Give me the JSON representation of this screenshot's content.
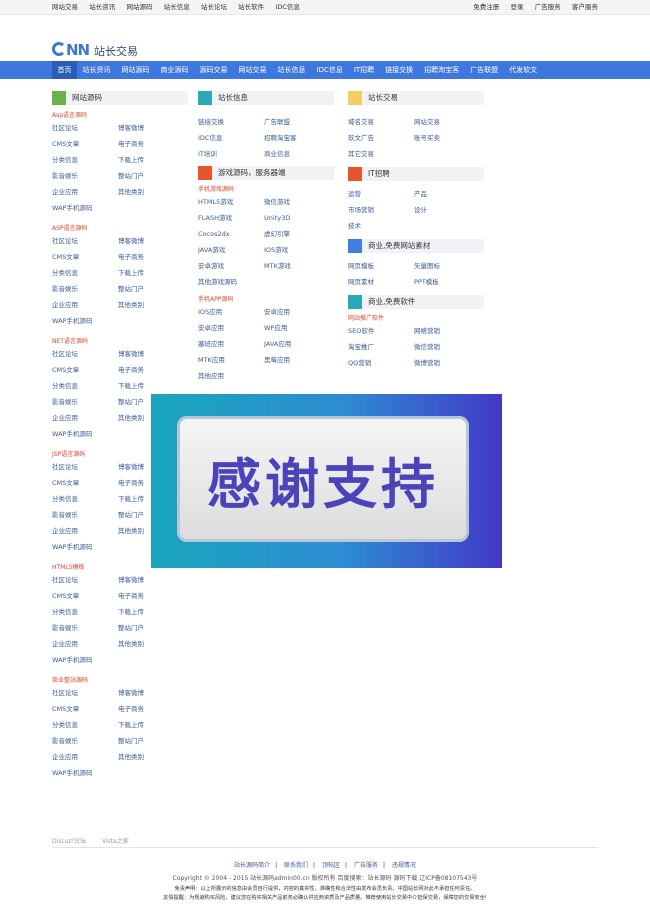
{
  "topbar": {
    "left": [
      "网站交易",
      "站长资讯",
      "网站源码",
      "站长信息",
      "站长论坛",
      "站长软件",
      "IDC信息"
    ],
    "right": [
      "免费注册",
      "登录",
      "广告服务",
      "客户服务"
    ]
  },
  "logo": {
    "mark_text": "NN",
    "text": "站长交易"
  },
  "nav": [
    "首页",
    "站长资讯",
    "网站源码",
    "商业源码",
    "源码交易",
    "网站交易",
    "站长信息",
    "IDC信息",
    "IT招聘",
    "链接交换",
    "招聘淘宝客",
    "广告联盟",
    "代发软文"
  ],
  "col1": {
    "title": "网站源码",
    "color": "#6ab04c",
    "groups": [
      {
        "sub": "Asp语言源码",
        "items": [
          "社区论坛",
          "博客微博",
          "CMS文章",
          "电子商务",
          "分类信息",
          "下载上传",
          "影音娱乐",
          "整站门户",
          "企业应用",
          "其他类别",
          "WAP手机源码"
        ]
      },
      {
        "sub": "ASP语言源码",
        "items": [
          "社区论坛",
          "博客微博",
          "CMS文章",
          "电子商务",
          "分类信息",
          "下载上传",
          "影音娱乐",
          "整站门户",
          "企业应用",
          "其他类别",
          "WAP手机源码"
        ]
      },
      {
        "sub": "NET语言源码",
        "items": [
          "社区论坛",
          "博客微博",
          "CMS文章",
          "电子商务",
          "分类信息",
          "下载上传",
          "影音娱乐",
          "整站门户",
          "企业应用",
          "其他类别",
          "WAP手机源码"
        ]
      },
      {
        "sub": "JSP语言源码",
        "items": [
          "社区论坛",
          "博客微博",
          "CMS文章",
          "电子商务",
          "分类信息",
          "下载上传",
          "影音娱乐",
          "整站门户",
          "企业应用",
          "其他类别",
          "WAP手机源码"
        ]
      },
      {
        "sub": "HTML5模板",
        "items": [
          "社区论坛",
          "博客微博",
          "CMS文章",
          "电子商务",
          "分类信息",
          "下载上传",
          "影音娱乐",
          "整站门户",
          "企业应用",
          "其他类别",
          "WAP手机源码"
        ]
      },
      {
        "sub": "商业整站源码",
        "items": [
          "社区论坛",
          "博客微博",
          "CMS文章",
          "电子商务",
          "分类信息",
          "下载上传",
          "影音娱乐",
          "整站门户",
          "企业应用",
          "其他类别",
          "WAP手机源码"
        ]
      }
    ]
  },
  "col2": {
    "s1": {
      "title": "站长信息",
      "color": "#28aab8",
      "items": [
        "链接交换",
        "广告联盟",
        "IDC信息",
        "招聘淘宝客",
        "IT培训",
        "商业信息"
      ]
    },
    "s2": {
      "title": "游戏源码，服务器端",
      "color": "#e8542b",
      "g1": {
        "sub": "手机游戏源码",
        "items": [
          "HTML5游戏",
          "微信游戏",
          "FLASH游戏",
          "Unity3D",
          "Cocos2dx",
          "虚幻引擎",
          "JAVA游戏",
          "IOS游戏",
          "安卓游戏",
          "MTK游戏",
          "其他游戏源码"
        ]
      },
      "g2": {
        "sub": "手机APP源码",
        "items": [
          "IOS应用",
          "安卓应用",
          "安卓应用",
          "WP应用",
          "塞班应用",
          "JAVA应用",
          "MTK应用",
          "黑莓应用",
          "其他应用"
        ]
      }
    }
  },
  "col3": {
    "s1": {
      "title": "站长交易",
      "color": "#f2cf63",
      "items": [
        "域名交易",
        "网站交易",
        "软文广告",
        "账号买卖",
        "其它交易"
      ]
    },
    "s2": {
      "title": "IT招聘",
      "color": "#e8542b",
      "items": [
        "运营",
        "产品",
        "市场营销",
        "设计",
        "技术"
      ]
    },
    "s3": {
      "title": "商业,免费网站素材",
      "color": "#3e7fe0",
      "items": [
        "网页模板",
        "矢量图标",
        "网页素材",
        "PPT模板"
      ]
    },
    "s4": {
      "title": "商业,免费软件",
      "color": "#28aab8",
      "sub": "网站推广软件",
      "items": [
        "SEO软件",
        "网络营销",
        "淘宝推广",
        "微信营销",
        "QQ营销",
        "微博营销"
      ]
    }
  },
  "overlay": {
    "text": "感谢支持"
  },
  "footer": {
    "links": [
      "Discuz!论坛",
      "Vista之家"
    ],
    "nav": [
      "站长源码简介",
      "联系我们",
      "顶帖区",
      "广告服务",
      "违规情况"
    ],
    "copy": "Copyright © 2004 - 2015 站长源码admin00.cn 版权所有 百度搜索：站长源码 源码下载 辽ICP备08107543号",
    "note1": "免责声明：以上所展示的信息由会员自行提供，内容的真实性、准确性和合法性由发布会员负责。中国站长网对此不承担任何责任。",
    "note2": "友情提醒：为规避购买风险，建议您在购买相关产品前务必确认供应商资质及产品质量。推荐使用站长交易中介担保交易，保障您的交易安全!"
  }
}
